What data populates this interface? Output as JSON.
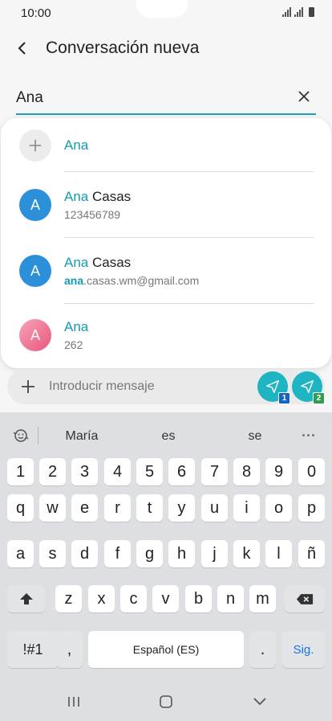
{
  "status": {
    "time": "10:00"
  },
  "header": {
    "title": "Conversación nueva"
  },
  "search": {
    "value": "Ana"
  },
  "suggestions": [
    {
      "kind": "add",
      "name_hl": "Ana",
      "name_rest": "",
      "sub_hl": "",
      "sub_rest": ""
    },
    {
      "kind": "contact",
      "initial": "A",
      "avatar_color": "#2b8fd9",
      "name_hl": "Ana",
      "name_rest": " Casas",
      "sub_hl": "",
      "sub_rest": "123456789"
    },
    {
      "kind": "contact",
      "initial": "A",
      "avatar_color": "#2b8fd9",
      "name_hl": "Ana",
      "name_rest": " Casas",
      "sub_hl": "ana",
      "sub_rest": ".casas.wm@gmail.com"
    },
    {
      "kind": "contact",
      "initial": "A",
      "avatar_color": "#ef6f8e",
      "name_hl": "Ana",
      "name_rest": "",
      "sub_hl": "",
      "sub_rest": "262"
    }
  ],
  "composer": {
    "placeholder": "Introducir mensaje",
    "sim1_badge": "1",
    "sim2_badge": "2"
  },
  "keyboard": {
    "suggestions": [
      "María",
      "es",
      "se"
    ],
    "row_numbers": [
      "1",
      "2",
      "3",
      "4",
      "5",
      "6",
      "7",
      "8",
      "9",
      "0"
    ],
    "row_1": [
      "q",
      "w",
      "e",
      "r",
      "t",
      "y",
      "u",
      "i",
      "o",
      "p"
    ],
    "row_2": [
      "a",
      "s",
      "d",
      "f",
      "g",
      "h",
      "j",
      "k",
      "l",
      "ñ"
    ],
    "row_3": [
      "z",
      "x",
      "c",
      "v",
      "b",
      "n",
      "m"
    ],
    "symbols_label": "!#1",
    "comma_label": ",",
    "space_label": "Español (ES)",
    "period_label": ".",
    "next_label": "Sig."
  },
  "colors": {
    "accent": "#159bb5",
    "send": "#1eb4c2",
    "badge1": "#1565c0",
    "badge2": "#2e9e4f"
  }
}
